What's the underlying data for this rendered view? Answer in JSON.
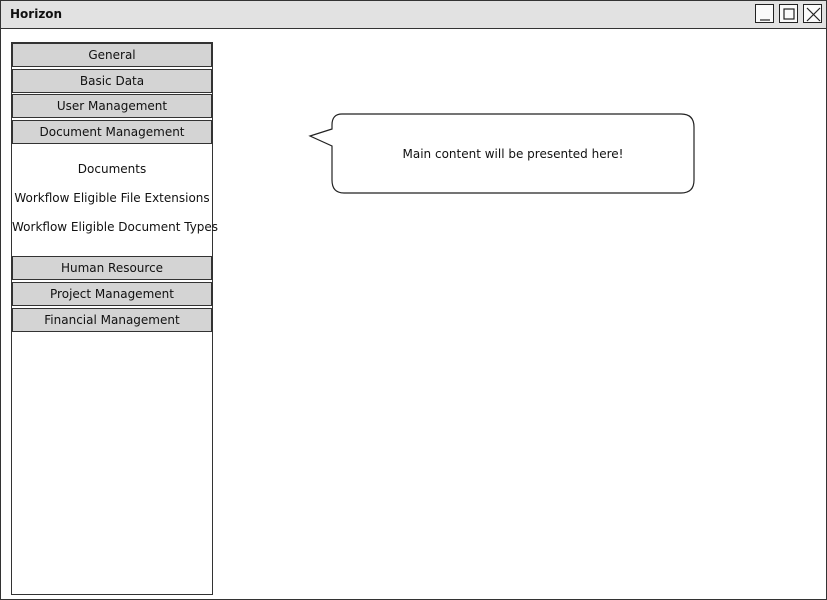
{
  "window": {
    "title": "Horizon"
  },
  "sidebar": {
    "sections": [
      {
        "label": "General"
      },
      {
        "label": "Basic Data"
      },
      {
        "label": "User Management"
      },
      {
        "label": "Document Management"
      },
      {
        "label": "Human Resource"
      },
      {
        "label": "Project Management"
      },
      {
        "label": "Financial Management"
      }
    ],
    "document_management_items": [
      {
        "label": "Documents"
      },
      {
        "label": "Workflow Eligible File Extensions"
      },
      {
        "label": "Workflow Eligible Document Types"
      }
    ]
  },
  "main": {
    "callout_text": "Main content will be presented here!"
  }
}
